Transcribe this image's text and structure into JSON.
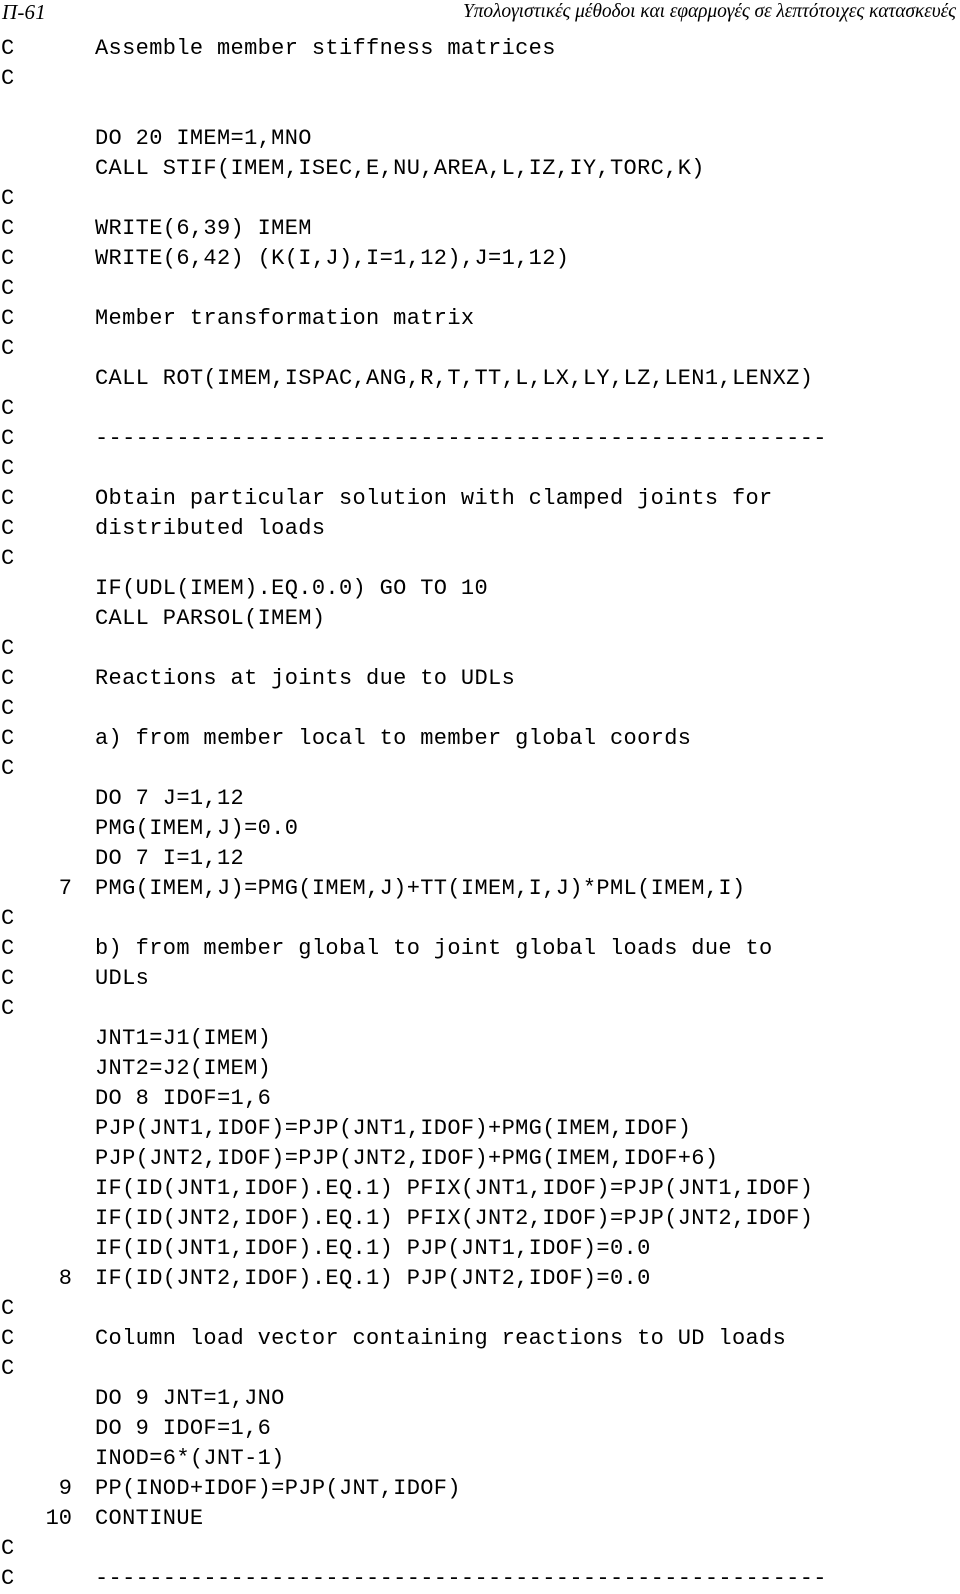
{
  "header": {
    "page_number": "Π-61",
    "running_title": "Υπολογιστικές μέθοδοι και εφαρμογές σε λεπτότοιχες κατασκευές"
  },
  "listing": {
    "language": "FORTRAN",
    "comment_marker": "C",
    "separator": "------------------------------------------------------",
    "lines": [
      {
        "marker": "C",
        "label": "",
        "text": "Assemble member stiffness matrices"
      },
      {
        "marker": "C",
        "label": "",
        "text": ""
      },
      {
        "marker": "",
        "label": "",
        "text": ""
      },
      {
        "marker": "",
        "label": "",
        "text": "DO 20 IMEM=1,MNO"
      },
      {
        "marker": "",
        "label": "",
        "text": "CALL STIF(IMEM,ISEC,E,NU,AREA,L,IZ,IY,TORC,K)"
      },
      {
        "marker": "C",
        "label": "",
        "text": ""
      },
      {
        "marker": "C",
        "label": "",
        "text": "WRITE(6,39) IMEM"
      },
      {
        "marker": "C",
        "label": "",
        "text": "WRITE(6,42) (K(I,J),I=1,12),J=1,12)"
      },
      {
        "marker": "C",
        "label": "",
        "text": ""
      },
      {
        "marker": "C",
        "label": "",
        "text": "Member transformation matrix"
      },
      {
        "marker": "C",
        "label": "",
        "text": ""
      },
      {
        "marker": "",
        "label": "",
        "text": "CALL ROT(IMEM,ISPAC,ANG,R,T,TT,L,LX,LY,LZ,LEN1,LENXZ)"
      },
      {
        "marker": "C",
        "label": "",
        "text": ""
      },
      {
        "marker": "C",
        "label": "",
        "text": "------------------------------------------------------"
      },
      {
        "marker": "C",
        "label": "",
        "text": ""
      },
      {
        "marker": "C",
        "label": "",
        "text": "Obtain particular solution with clamped joints for"
      },
      {
        "marker": "C",
        "label": "",
        "text": "distributed loads"
      },
      {
        "marker": "C",
        "label": "",
        "text": ""
      },
      {
        "marker": "",
        "label": "",
        "text": "IF(UDL(IMEM).EQ.0.0) GO TO 10"
      },
      {
        "marker": "",
        "label": "",
        "text": "CALL PARSOL(IMEM)"
      },
      {
        "marker": "C",
        "label": "",
        "text": ""
      },
      {
        "marker": "C",
        "label": "",
        "text": "Reactions at joints due to UDLs"
      },
      {
        "marker": "C",
        "label": "",
        "text": ""
      },
      {
        "marker": "C",
        "label": "",
        "text": "a) from member local to member global coords"
      },
      {
        "marker": "C",
        "label": "",
        "text": ""
      },
      {
        "marker": "",
        "label": "",
        "text": "DO 7 J=1,12"
      },
      {
        "marker": "",
        "label": "",
        "text": "PMG(IMEM,J)=0.0"
      },
      {
        "marker": "",
        "label": "",
        "text": "DO 7 I=1,12"
      },
      {
        "marker": "",
        "label": "7",
        "text": "PMG(IMEM,J)=PMG(IMEM,J)+TT(IMEM,I,J)*PML(IMEM,I)"
      },
      {
        "marker": "C",
        "label": "",
        "text": ""
      },
      {
        "marker": "C",
        "label": "",
        "text": "b) from member global to joint global loads due to"
      },
      {
        "marker": "C",
        "label": "",
        "text": "UDLs"
      },
      {
        "marker": "C",
        "label": "",
        "text": ""
      },
      {
        "marker": "",
        "label": "",
        "text": "JNT1=J1(IMEM)"
      },
      {
        "marker": "",
        "label": "",
        "text": "JNT2=J2(IMEM)"
      },
      {
        "marker": "",
        "label": "",
        "text": "DO 8 IDOF=1,6"
      },
      {
        "marker": "",
        "label": "",
        "text": "PJP(JNT1,IDOF)=PJP(JNT1,IDOF)+PMG(IMEM,IDOF)"
      },
      {
        "marker": "",
        "label": "",
        "text": "PJP(JNT2,IDOF)=PJP(JNT2,IDOF)+PMG(IMEM,IDOF+6)"
      },
      {
        "marker": "",
        "label": "",
        "text": "IF(ID(JNT1,IDOF).EQ.1) PFIX(JNT1,IDOF)=PJP(JNT1,IDOF)"
      },
      {
        "marker": "",
        "label": "",
        "text": "IF(ID(JNT2,IDOF).EQ.1) PFIX(JNT2,IDOF)=PJP(JNT2,IDOF)"
      },
      {
        "marker": "",
        "label": "",
        "text": "IF(ID(JNT1,IDOF).EQ.1) PJP(JNT1,IDOF)=0.0"
      },
      {
        "marker": "",
        "label": "8",
        "text": "IF(ID(JNT2,IDOF).EQ.1) PJP(JNT2,IDOF)=0.0"
      },
      {
        "marker": "C",
        "label": "",
        "text": ""
      },
      {
        "marker": "C",
        "label": "",
        "text": "Column load vector containing reactions to UD loads"
      },
      {
        "marker": "C",
        "label": "",
        "text": ""
      },
      {
        "marker": "",
        "label": "",
        "text": "DO 9 JNT=1,JNO"
      },
      {
        "marker": "",
        "label": "",
        "text": "DO 9 IDOF=1,6"
      },
      {
        "marker": "",
        "label": "",
        "text": "INOD=6*(JNT-1)"
      },
      {
        "marker": "",
        "label": "9",
        "text": "PP(INOD+IDOF)=PJP(JNT,IDOF)"
      },
      {
        "marker": "",
        "label": "10",
        "text": "CONTINUE"
      },
      {
        "marker": "C",
        "label": "",
        "text": ""
      },
      {
        "marker": "C",
        "label": "",
        "text": "------------------------------------------------------"
      }
    ]
  }
}
